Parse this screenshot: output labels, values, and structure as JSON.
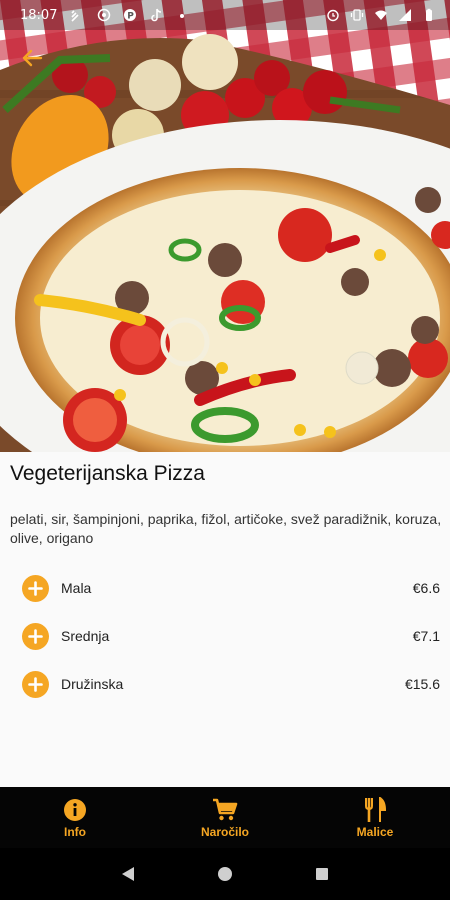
{
  "status_bar": {
    "time": "18:07",
    "left_icons": [
      "signal-icon",
      "viber-icon",
      "parking-icon",
      "tiktok-icon",
      "dot-icon"
    ],
    "right_icons": [
      "alarm-icon",
      "vibrate-icon",
      "wifi-icon",
      "cellular-icon",
      "battery-icon"
    ]
  },
  "header": {
    "back_icon": "arrow-left-icon"
  },
  "product": {
    "name": "Vegeterijanska Pizza",
    "ingredients": "pelati, sir, šampinjoni, paprika, fižol, artičoke, svež paradižnik, koruza, olive, origano"
  },
  "sizes": [
    {
      "label": "Mala",
      "price": "€6.6"
    },
    {
      "label": "Srednja",
      "price": "€7.1"
    },
    {
      "label": "Družinska",
      "price": "€15.6"
    }
  ],
  "bottom_nav": [
    {
      "label": "Info",
      "icon": "info-icon"
    },
    {
      "label": "Naročilo",
      "icon": "cart-icon"
    },
    {
      "label": "Malice",
      "icon": "cutlery-icon"
    }
  ],
  "system_nav": [
    "back-triangle-icon",
    "home-circle-icon",
    "recents-square-icon"
  ],
  "colors": {
    "accent": "#f5a623",
    "nav_background": "#050505",
    "content_background": "#fafafa"
  }
}
